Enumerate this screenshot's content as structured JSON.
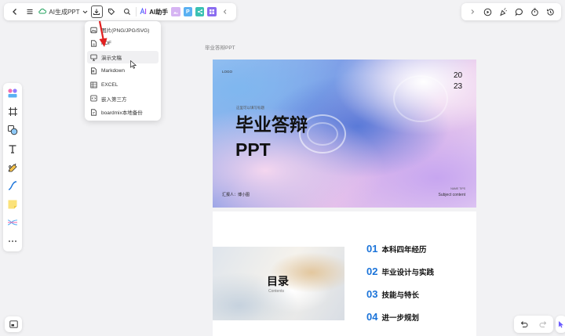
{
  "top_toolbar": {
    "title": "AI生成PPT",
    "ai_logo": "AI",
    "ai_assistant": "AI助手",
    "plugin_p": "P"
  },
  "dropdown": {
    "items": [
      {
        "label": "图片(PNG/JPG/SVG)",
        "icon": "image-icon"
      },
      {
        "label": "PDF",
        "icon": "pdf-icon"
      },
      {
        "label": "演示文稿",
        "icon": "presentation-icon"
      },
      {
        "label": "Markdown",
        "icon": "markdown-icon"
      },
      {
        "label": "EXCEL",
        "icon": "excel-icon"
      },
      {
        "label": "嵌入第三方",
        "icon": "embed-icon"
      },
      {
        "label": "boardmix本地备份",
        "icon": "backup-icon"
      }
    ]
  },
  "canvas": {
    "page_label": "毕业答辩PPT"
  },
  "slide1": {
    "logo": "LOGO",
    "year_top": "20",
    "year_bottom": "23",
    "small_text": "这里可以填写标题",
    "title_line1": "毕业答辩",
    "title_line2": "PPT",
    "presenter": "汇报人：博小图",
    "name_tag": "NAME TIPS",
    "subject": "Subject content"
  },
  "slide2": {
    "title": "目录",
    "subtitle": "Contents",
    "toc": [
      {
        "num": "01",
        "text": "本科四年经历"
      },
      {
        "num": "02",
        "text": "毕业设计与实践"
      },
      {
        "num": "03",
        "text": "技能与特长"
      },
      {
        "num": "04",
        "text": "进一步规划"
      }
    ]
  },
  "colors": {
    "accent_blue": "#1a73d9",
    "arrow_red": "#e02020"
  }
}
